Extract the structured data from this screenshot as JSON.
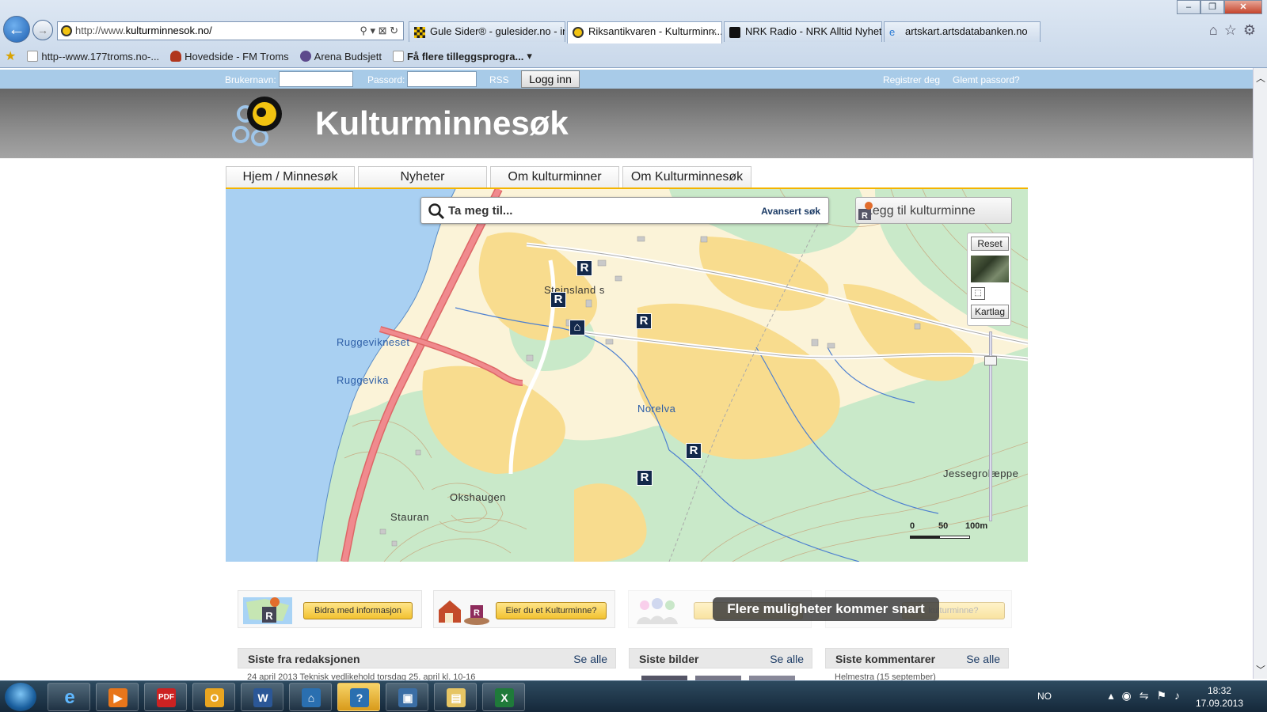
{
  "browser": {
    "address": "http://www.kulturminnesok.no/",
    "address_plain": "http://www.",
    "address_host": "kulturminnesok.no/",
    "tabs": [
      {
        "label": "Gule Sider® - gulesider.no - in..."
      },
      {
        "label": "Riksantikvaren - Kulturminn...",
        "close": "×"
      },
      {
        "label": "NRK Radio - NRK Alltid Nyhete..."
      },
      {
        "label": "artskart.artsdatabanken.no"
      }
    ],
    "favorites": [
      {
        "label": "http--www.177troms.no-..."
      },
      {
        "label": "Hovedside - FM Troms"
      },
      {
        "label": "Arena Budsjett"
      },
      {
        "label": "Få flere tilleggsprogra..."
      }
    ]
  },
  "login": {
    "username_label": "Brukernavn:",
    "password_label": "Passord:",
    "rss": "RSS",
    "login_button": "Logg inn",
    "register": "Registrer deg",
    "forgot": "Glemt passord?"
  },
  "site": {
    "title": "Kulturminnesøk"
  },
  "nav": {
    "tabs": [
      {
        "label": "Hjem / Minnesøk"
      },
      {
        "label": "Nyheter"
      },
      {
        "label": "Om kulturminner"
      },
      {
        "label": "Om Kulturminnesøk"
      }
    ]
  },
  "map": {
    "search_placeholder": "Ta meg til...",
    "advanced_search": "Avansert søk",
    "add_button": "Legg til kulturminne",
    "reset": "Reset",
    "layers": "Kartlag",
    "place_names": {
      "steinsland": "Steinsland",
      "steinsland_s": "s",
      "ruggevikneset": "Ruggevikneset",
      "ruggevika": "Ruggevika",
      "norelva": "Norelva",
      "okshaugen": "Okshaugen",
      "stauran": "Stauran",
      "jessegrolaeppe": "Jessegrolæppe"
    },
    "scale": {
      "t0": "0",
      "t1": "50",
      "t2": "100m"
    },
    "colors": {
      "forest": "#c9e9c9",
      "field": "#f8dc8e",
      "water": "#a9d0f2",
      "road": "#e8686c",
      "marker": "#13294b"
    }
  },
  "promos": [
    {
      "label": "Bidra med informasjon"
    },
    {
      "label": "Eier du et Kulturminne?"
    },
    {
      "label": ""
    },
    {
      "label": "kulturminne?"
    }
  ],
  "promo_overlay": "Flere muligheter kommer snart",
  "panels": [
    {
      "title": "Siste fra redaksjonen",
      "see_all": "Se alle",
      "snippet": "24 april 2013    Teknisk vedlikehold torsdag 25. april kl. 10-16"
    },
    {
      "title": "Siste bilder",
      "see_all": "Se alle",
      "snippet": ""
    },
    {
      "title": "Siste kommentarer",
      "see_all": "Se alle",
      "snippet": "Helmestra (15 september)"
    }
  ],
  "taskbar": {
    "language": "NO",
    "time": "18:32",
    "date": "17.09.2013"
  }
}
